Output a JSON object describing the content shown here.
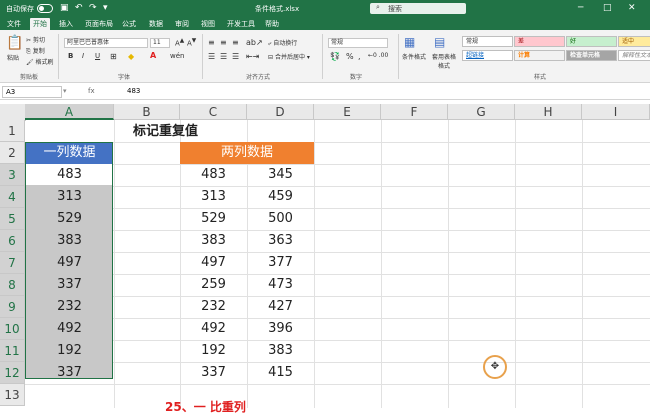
{
  "titlebar": {
    "autosave": "自动保存",
    "doc_title": "条件格式.xlsx",
    "search_placeholder": "搜索"
  },
  "tabs": [
    "文件",
    "开始",
    "插入",
    "页面布局",
    "公式",
    "数据",
    "审阅",
    "视图",
    "开发工具",
    "帮助"
  ],
  "active_tab": "开始",
  "ribbon": {
    "clipboard": {
      "paste": "粘贴",
      "cut": "剪切",
      "copy": "复制",
      "format_painter": "格式刷",
      "label": "剪贴板"
    },
    "font": {
      "name": "阿里巴巴普惠体",
      "size": "11",
      "label": "字体",
      "bold": "B",
      "italic": "I",
      "underline": "U"
    },
    "alignment": {
      "wrap": "自动换行",
      "merge": "合并后居中",
      "label": "对齐方式"
    },
    "number": {
      "format": "常规",
      "label": "数字",
      "percent": "%",
      "comma": ","
    },
    "styles": {
      "conditional": "条件格式",
      "table": "套用表格格式",
      "label": "样式",
      "cells": [
        "常规",
        "差",
        "好",
        "适中",
        "超链接",
        "计算",
        "检查单元格",
        "解释性文本"
      ]
    }
  },
  "formula_bar": {
    "name_box": "A3",
    "fx": "fx",
    "value": "483"
  },
  "columns": [
    "A",
    "B",
    "C",
    "D",
    "E",
    "F",
    "G",
    "H",
    "I"
  ],
  "rows": [
    "1",
    "2",
    "3",
    "4",
    "5",
    "6",
    "7",
    "8",
    "9",
    "10",
    "11",
    "12",
    "13"
  ],
  "sheet": {
    "title": "标记重复值",
    "header_a": "一列数据",
    "header_cd": "两列数据",
    "col_a": [
      "483",
      "313",
      "529",
      "383",
      "497",
      "337",
      "232",
      "492",
      "192",
      "337"
    ],
    "col_c": [
      "483",
      "313",
      "529",
      "383",
      "497",
      "259",
      "232",
      "492",
      "192",
      "337"
    ],
    "col_d": [
      "345",
      "459",
      "500",
      "363",
      "377",
      "473",
      "427",
      "396",
      "383",
      "415"
    ]
  },
  "caption": "25、一   比重列",
  "colors": {
    "excel_green": "#217346",
    "header_blue": "#4472c4",
    "header_orange": "#f0802f"
  }
}
